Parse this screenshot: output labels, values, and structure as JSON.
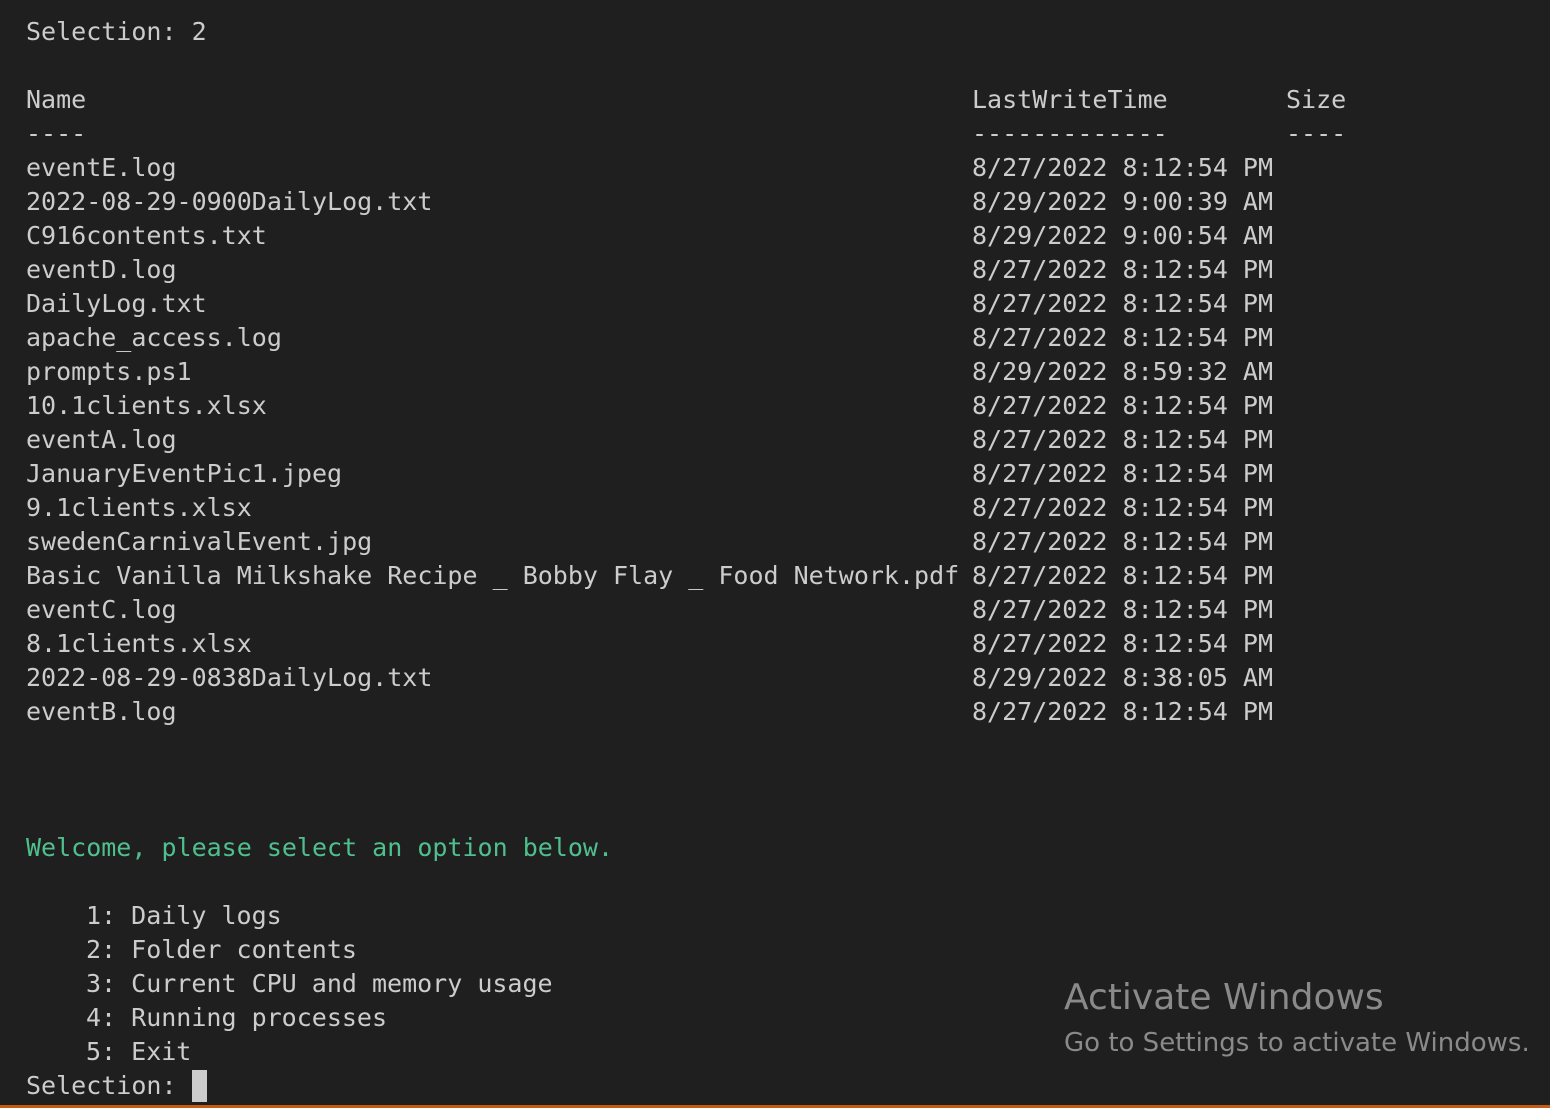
{
  "previous_prompt": {
    "label": "Selection:",
    "value": "2"
  },
  "table": {
    "headers": {
      "name": "Name",
      "time": "LastWriteTime",
      "size": "Size"
    },
    "underlines": {
      "name": "----",
      "time": "-------------",
      "size": "----"
    },
    "rows": [
      {
        "name": "eventE.log",
        "time": "8/27/2022 8:12:54 PM"
      },
      {
        "name": "2022-08-29-0900DailyLog.txt",
        "time": "8/29/2022 9:00:39 AM"
      },
      {
        "name": "C916contents.txt",
        "time": "8/29/2022 9:00:54 AM"
      },
      {
        "name": "eventD.log",
        "time": "8/27/2022 8:12:54 PM"
      },
      {
        "name": "DailyLog.txt",
        "time": "8/27/2022 8:12:54 PM"
      },
      {
        "name": "apache_access.log",
        "time": "8/27/2022 8:12:54 PM"
      },
      {
        "name": "prompts.ps1",
        "time": "8/29/2022 8:59:32 AM"
      },
      {
        "name": "10.1clients.xlsx",
        "time": "8/27/2022 8:12:54 PM"
      },
      {
        "name": "eventA.log",
        "time": "8/27/2022 8:12:54 PM"
      },
      {
        "name": "JanuaryEventPic1.jpeg",
        "time": "8/27/2022 8:12:54 PM"
      },
      {
        "name": "9.1clients.xlsx",
        "time": "8/27/2022 8:12:54 PM"
      },
      {
        "name": "swedenCarnivalEvent.jpg",
        "time": "8/27/2022 8:12:54 PM"
      },
      {
        "name": "Basic Vanilla Milkshake Recipe _ Bobby Flay _ Food Network.pdf",
        "time": "8/27/2022 8:12:54 PM"
      },
      {
        "name": "eventC.log",
        "time": "8/27/2022 8:12:54 PM"
      },
      {
        "name": "8.1clients.xlsx",
        "time": "8/27/2022 8:12:54 PM"
      },
      {
        "name": "2022-08-29-0838DailyLog.txt",
        "time": "8/29/2022 8:38:05 AM"
      },
      {
        "name": "eventB.log",
        "time": "8/27/2022 8:12:54 PM"
      }
    ]
  },
  "welcome": "Welcome, please select an option below.",
  "menu": [
    "1: Daily logs",
    "2: Folder contents",
    "3: Current CPU and memory usage",
    "4: Running processes",
    "5: Exit"
  ],
  "current_prompt": {
    "label": "Selection: "
  },
  "watermark": {
    "title": "Activate Windows",
    "subtitle": "Go to Settings to activate Windows."
  },
  "colors": {
    "background": "#1f1f1f",
    "text": "#cccccc",
    "welcome": "#4fc08d",
    "watermark": "#8a8a8a",
    "bottom_border": "#c25b15"
  }
}
